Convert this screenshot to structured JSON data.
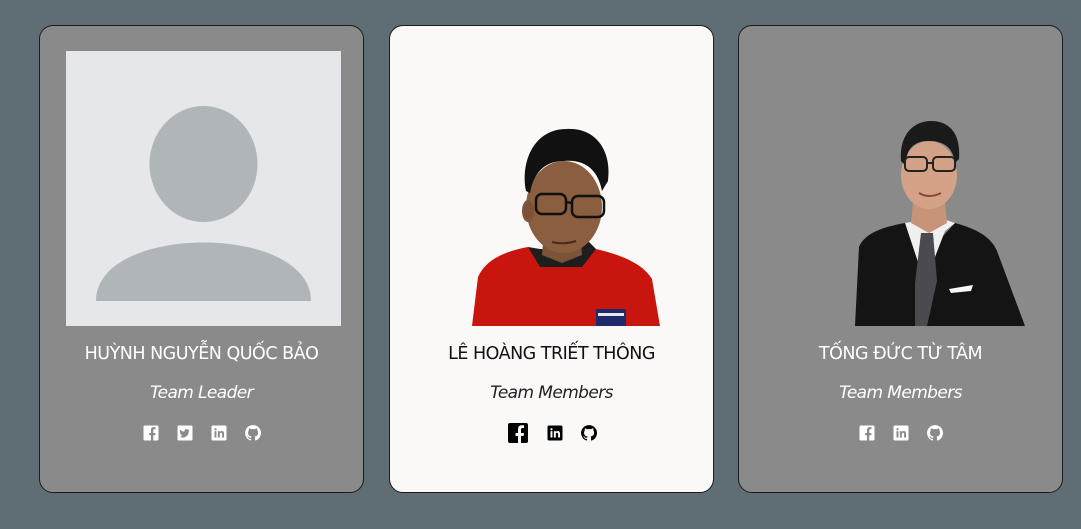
{
  "members": [
    {
      "name": "HUỲNH NGUYỄN QUỐC BẢO",
      "role": "Team Leader",
      "photo": "default-avatar-placeholder",
      "socials": [
        "facebook-icon",
        "twitter-icon",
        "linkedin-icon",
        "github-icon"
      ]
    },
    {
      "name": "LÊ HOÀNG TRIẾT THÔNG",
      "role": "Team Members",
      "photo": "member-photo-red-shirt",
      "socials": [
        "facebook-icon",
        "linkedin-icon",
        "github-icon"
      ]
    },
    {
      "name": "TỐNG ĐỨC TỪ TÂM",
      "role": "Team Members",
      "photo": "member-photo-black-suit",
      "socials": [
        "facebook-icon",
        "linkedin-icon",
        "github-icon"
      ]
    }
  ],
  "colors": {
    "page_background": "#5f6d75",
    "card_background": "#8a8a8a",
    "active_card_background": "#fbf8f8",
    "placeholder_background": "#e5e7ea",
    "placeholder_figure": "#b0b5ba"
  }
}
